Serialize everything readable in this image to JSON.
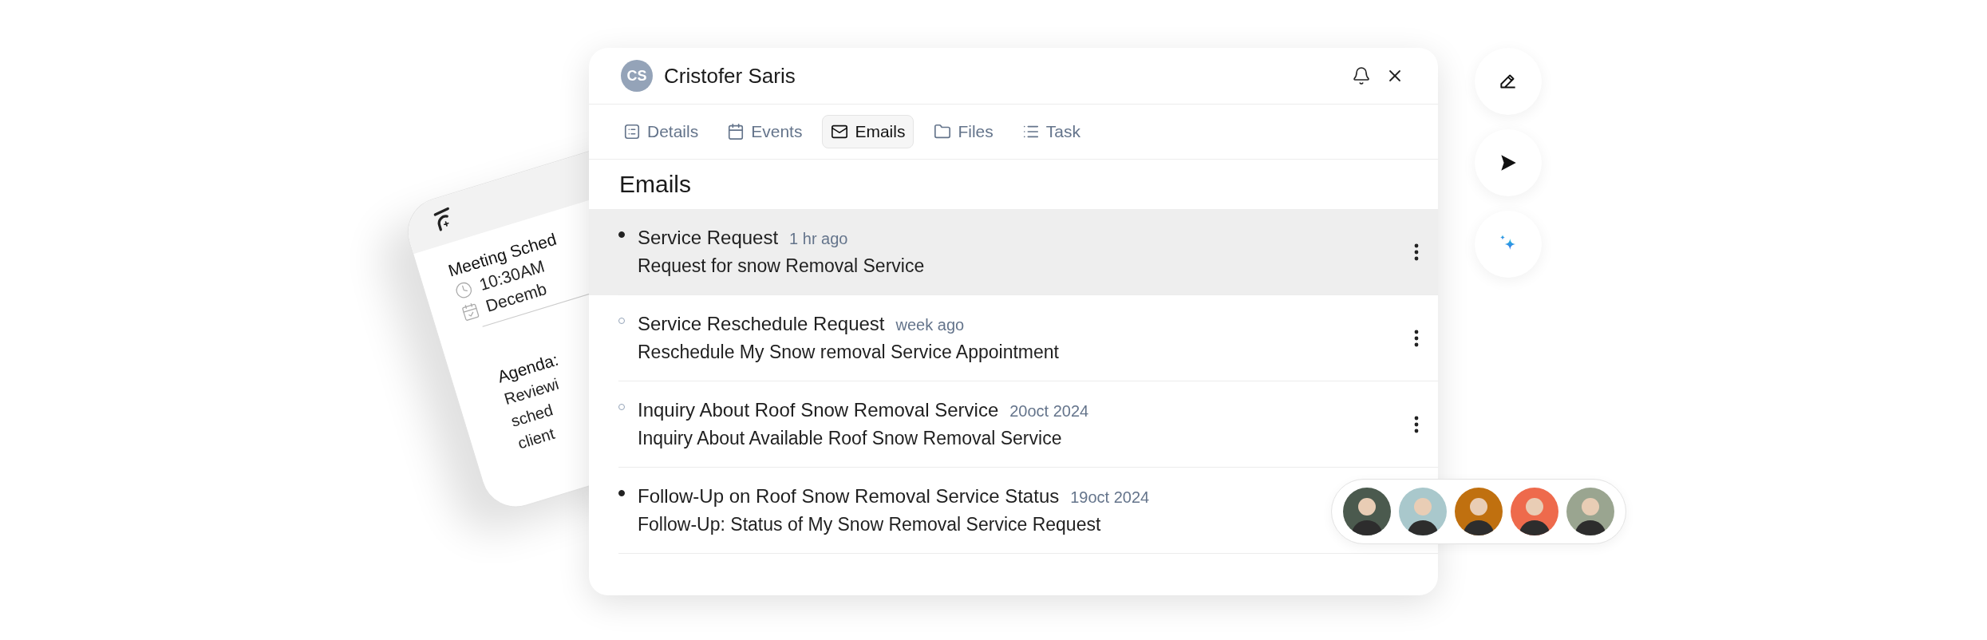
{
  "meeting_card": {
    "title": "Meeting Sched",
    "time": "10:30AM",
    "date": "Decemb",
    "agenda_label": "Agenda:",
    "agenda_lines": [
      "Reviewi",
      "sched",
      "client"
    ]
  },
  "contact": {
    "initials": "CS",
    "name": "Cristofer Saris"
  },
  "tabs": [
    {
      "label": "Details",
      "kind": "details",
      "selected": false
    },
    {
      "label": "Events",
      "kind": "events",
      "selected": false
    },
    {
      "label": "Emails",
      "kind": "emails",
      "selected": true
    },
    {
      "label": "Files",
      "kind": "files",
      "selected": false
    },
    {
      "label": "Task",
      "kind": "task",
      "selected": false
    }
  ],
  "section_title": "Emails",
  "emails": [
    {
      "title": "Service Request",
      "time": "1 hr ago",
      "preview": "Request for snow Removal Service",
      "unread": true,
      "selected": true
    },
    {
      "title": "Service Reschedule Request",
      "time": "week ago",
      "preview": "Reschedule My Snow removal Service Appointment",
      "unread": false,
      "selected": false
    },
    {
      "title": "Inquiry About Roof Snow Removal Service",
      "time": "20oct 2024",
      "preview": "Inquiry About Available Roof Snow Removal Service",
      "unread": false,
      "selected": false
    },
    {
      "title": "Follow-Up on Roof Snow Removal Service Status",
      "time": "19oct 2024",
      "preview": "Follow-Up: Status of My Snow Removal Service Request",
      "unread": true,
      "selected": false
    }
  ],
  "actions": [
    {
      "kind": "edit"
    },
    {
      "kind": "send"
    },
    {
      "kind": "sparkle"
    }
  ],
  "participants": [
    {
      "color": "#4b5a4e"
    },
    {
      "color": "#a9c8cc"
    },
    {
      "color": "#c0700f"
    },
    {
      "color": "#ee6a4c"
    },
    {
      "color": "#9aa590"
    }
  ]
}
